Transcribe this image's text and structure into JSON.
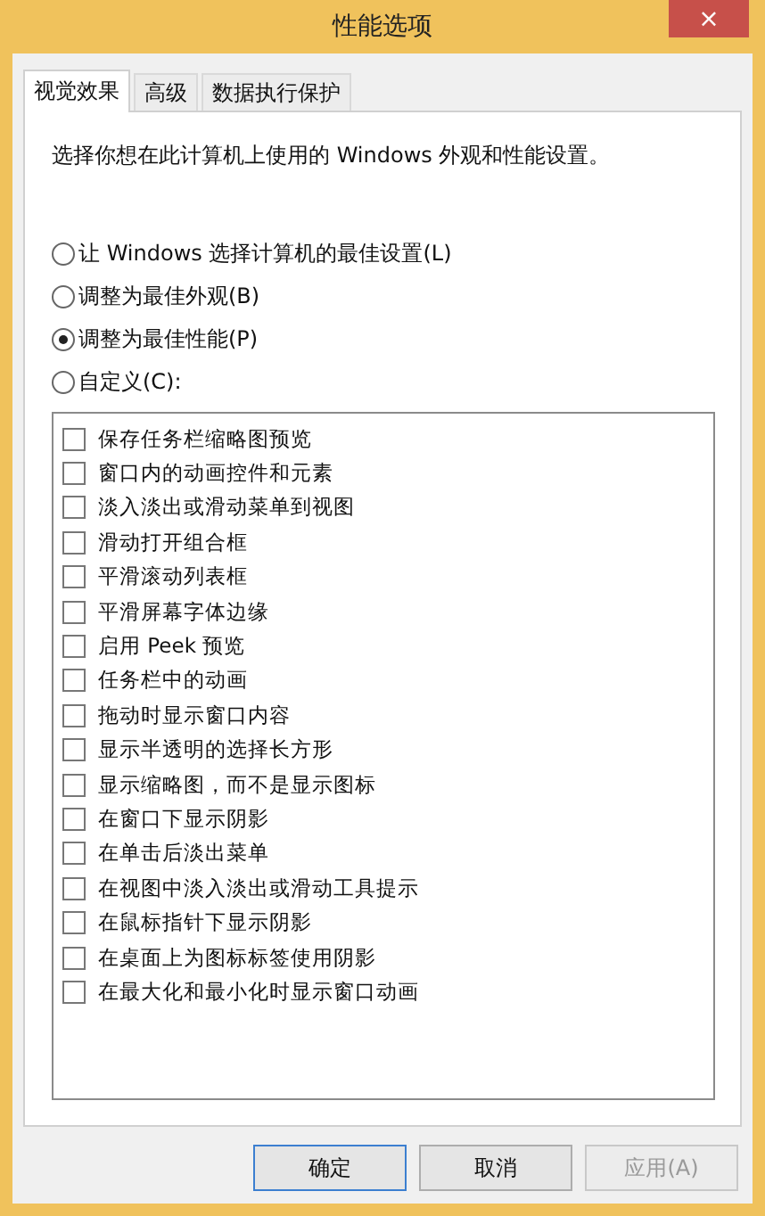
{
  "window": {
    "title": "性能选项",
    "close": "×"
  },
  "tabs": [
    {
      "label": "视觉效果",
      "selected": true
    },
    {
      "label": "高级",
      "selected": false
    },
    {
      "label": "数据执行保护",
      "selected": false
    }
  ],
  "description": "选择你想在此计算机上使用的 Windows 外观和性能设置。",
  "options": [
    {
      "label": "让 Windows 选择计算机的最佳设置(L)",
      "selected": false
    },
    {
      "label": "调整为最佳外观(B)",
      "selected": false
    },
    {
      "label": "调整为最佳性能(P)",
      "selected": true
    },
    {
      "label": "自定义(C):",
      "selected": false
    }
  ],
  "effects": [
    {
      "label": "保存任务栏缩略图预览",
      "checked": false
    },
    {
      "label": "窗口内的动画控件和元素",
      "checked": false
    },
    {
      "label": "淡入淡出或滑动菜单到视图",
      "checked": false
    },
    {
      "label": "滑动打开组合框",
      "checked": false
    },
    {
      "label": "平滑滚动列表框",
      "checked": false
    },
    {
      "label": "平滑屏幕字体边缘",
      "checked": false
    },
    {
      "label": "启用 Peek 预览",
      "checked": false
    },
    {
      "label": "任务栏中的动画",
      "checked": false
    },
    {
      "label": "拖动时显示窗口内容",
      "checked": false
    },
    {
      "label": "显示半透明的选择长方形",
      "checked": false
    },
    {
      "label": "显示缩略图，而不是显示图标",
      "checked": false
    },
    {
      "label": "在窗口下显示阴影",
      "checked": false
    },
    {
      "label": "在单击后淡出菜单",
      "checked": false
    },
    {
      "label": "在视图中淡入淡出或滑动工具提示",
      "checked": false
    },
    {
      "label": "在鼠标指针下显示阴影",
      "checked": false
    },
    {
      "label": "在桌面上为图标标签使用阴影",
      "checked": false
    },
    {
      "label": "在最大化和最小化时显示窗口动画",
      "checked": false
    }
  ],
  "buttons": [
    {
      "label": "确定",
      "disabled": false
    },
    {
      "label": "取消",
      "disabled": false
    },
    {
      "label": "应用(A)",
      "disabled": true
    }
  ]
}
